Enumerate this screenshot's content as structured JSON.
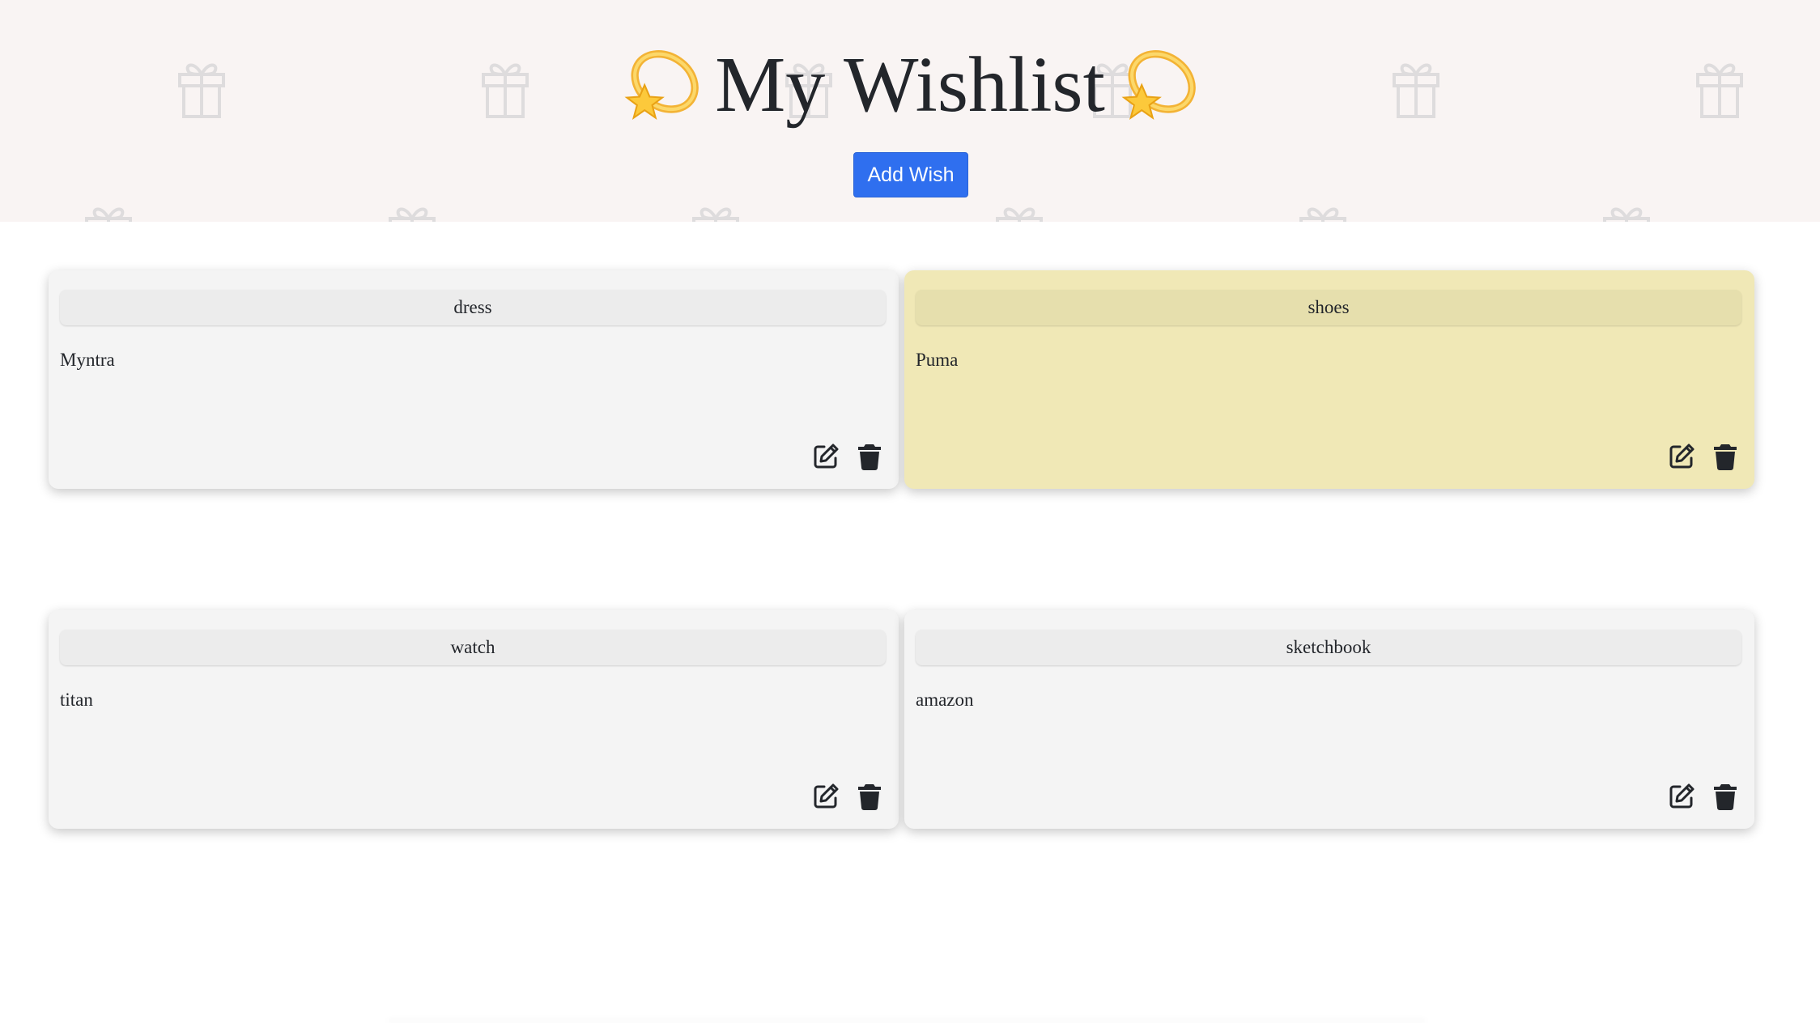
{
  "header": {
    "title": "My Wishlist",
    "title_emoji": "dizzy-star-icon",
    "background_pattern": "gift-icon",
    "add_button_label": "Add Wish"
  },
  "colors": {
    "header_bg": "#f9f4f3",
    "primary_button": "#2f6fef",
    "card_default": "#f4f4f4",
    "card_yellow": "#f0e8b6",
    "text": "#23262b"
  },
  "wishes": [
    {
      "title": "dress",
      "store": "Myntra",
      "color": "default"
    },
    {
      "title": "shoes",
      "store": "Puma",
      "color": "yellow"
    },
    {
      "title": "watch",
      "store": "titan",
      "color": "default"
    },
    {
      "title": "sketchbook",
      "store": "amazon",
      "color": "default"
    }
  ],
  "card_actions": {
    "edit_icon": "edit-icon",
    "delete_icon": "trash-icon"
  }
}
